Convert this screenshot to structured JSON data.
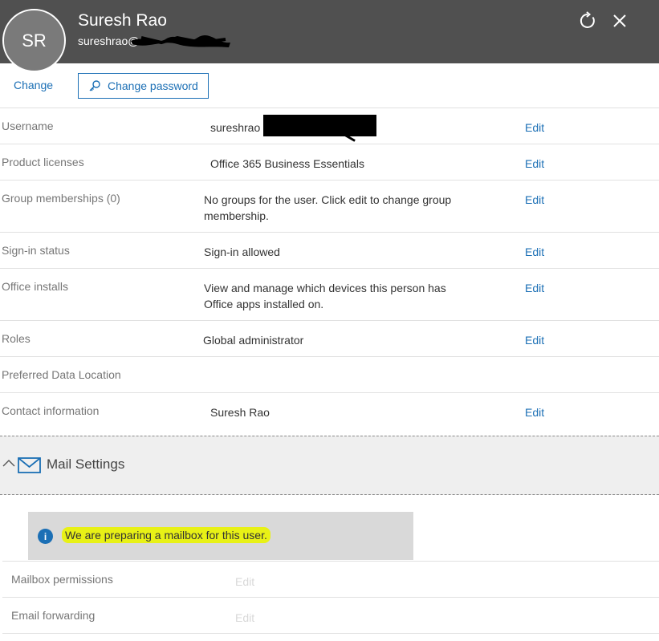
{
  "header": {
    "avatar_initials": "SR",
    "name": "Suresh Rao",
    "email_visible": "sureshrao@",
    "refresh_icon": "refresh-icon",
    "close_icon": "close-icon"
  },
  "actions": {
    "change_label": "Change",
    "change_password_label": "Change password",
    "key_icon": "key-icon"
  },
  "details": [
    {
      "label": "Username",
      "value": "sureshrao",
      "edit": "Edit"
    },
    {
      "label": "Product licenses",
      "value": "Office 365 Business Essentials",
      "edit": "Edit"
    },
    {
      "label": "Group memberships (0)",
      "value": "No groups for the user. Click edit to change group membership.",
      "edit": "Edit"
    },
    {
      "label": "Sign-in status",
      "value": "Sign-in allowed",
      "edit": "Edit"
    },
    {
      "label": "Office installs",
      "value": "View and manage which devices this person has Office apps installed on.",
      "edit": "Edit"
    },
    {
      "label": "Roles",
      "value": "Global administrator",
      "edit": "Edit"
    },
    {
      "label": "Preferred Data Location",
      "value": "",
      "edit": ""
    },
    {
      "label": "Contact information",
      "value": "Suresh Rao",
      "edit": "Edit"
    }
  ],
  "mail": {
    "title": "Mail Settings",
    "info_message": "We are preparing a mailbox for this user.",
    "rows": [
      {
        "label": "Mailbox permissions",
        "edit": "Edit"
      },
      {
        "label": "Email forwarding",
        "edit": "Edit"
      }
    ]
  },
  "colors": {
    "header_bg": "#505050",
    "link": "#1b6fb5",
    "highlight": "#e8f116",
    "info_box_bg": "#d9d9d9"
  }
}
